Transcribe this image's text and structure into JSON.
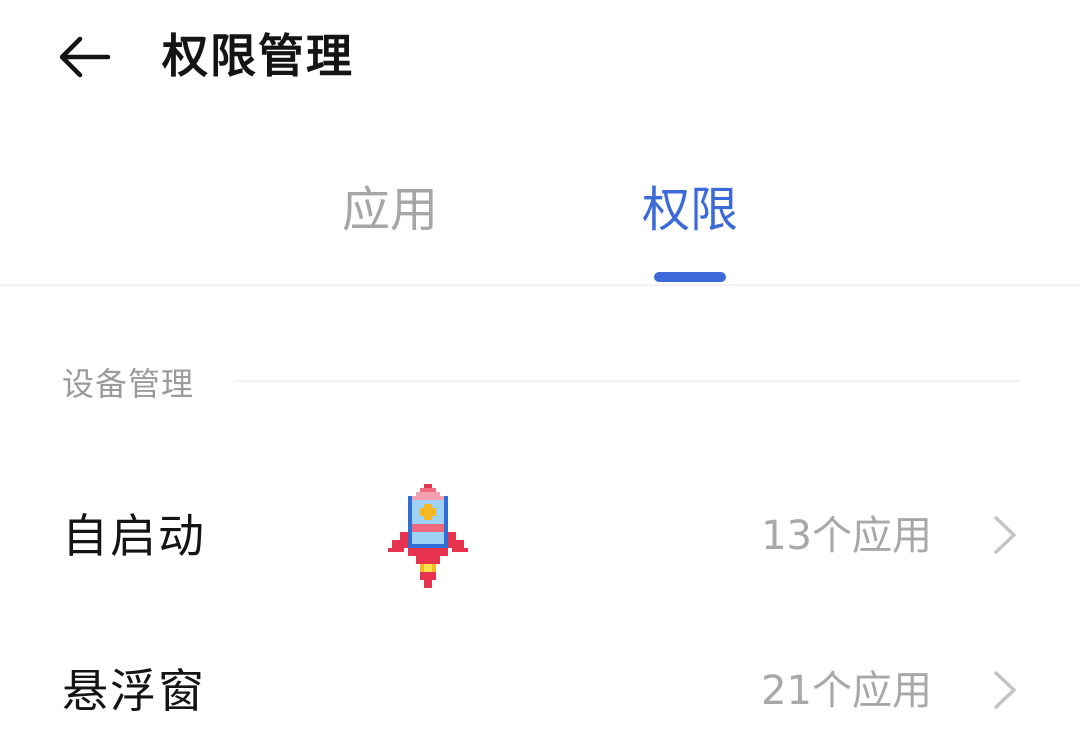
{
  "header": {
    "title": "权限管理",
    "back_icon": "arrow-left-icon"
  },
  "tabs": [
    {
      "label": "应用",
      "active": false
    },
    {
      "label": "权限",
      "active": true
    }
  ],
  "colors": {
    "accent": "#3c6ad8",
    "title_text": "#141414",
    "secondary_text": "#a8a8a8",
    "divider": "#f2f2f2"
  },
  "section": {
    "label": "设备管理"
  },
  "rows": [
    {
      "title": "自启动",
      "value": "13个应用",
      "chevron_icon": "chevron-right-icon"
    },
    {
      "title": "悬浮窗",
      "value": "21个应用",
      "chevron_icon": "chevron-right-icon"
    }
  ],
  "decoration": {
    "icon": "pixel-rocket-icon"
  }
}
